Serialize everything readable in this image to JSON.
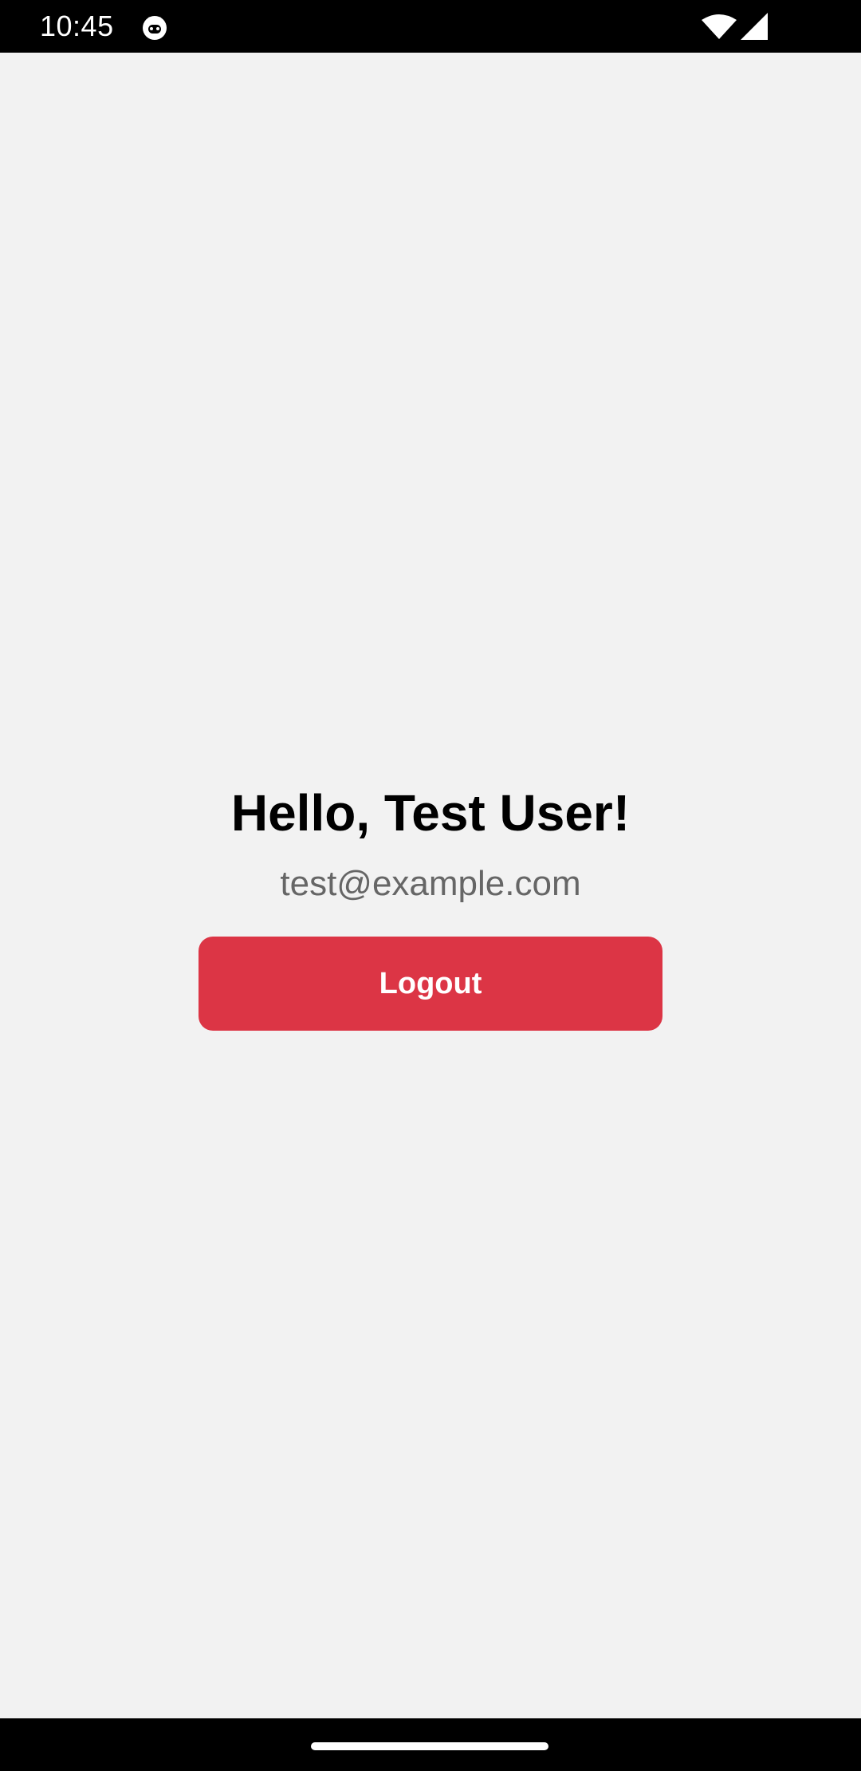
{
  "status_bar": {
    "time": "10:45",
    "app_icon": "cat-face-icon",
    "wifi_icon": "wifi-icon",
    "signal_icon": "cell-signal-icon"
  },
  "profile": {
    "greeting": "Hello, Test User!",
    "email": "test@example.com"
  },
  "actions": {
    "logout_label": "Logout"
  },
  "navigation": {
    "home_handle_icon": "home-gesture-handle"
  },
  "colors": {
    "background": "#f2f2f2",
    "logout_button": "#dc3545",
    "email_text": "#666666",
    "system_bars": "#000000"
  }
}
